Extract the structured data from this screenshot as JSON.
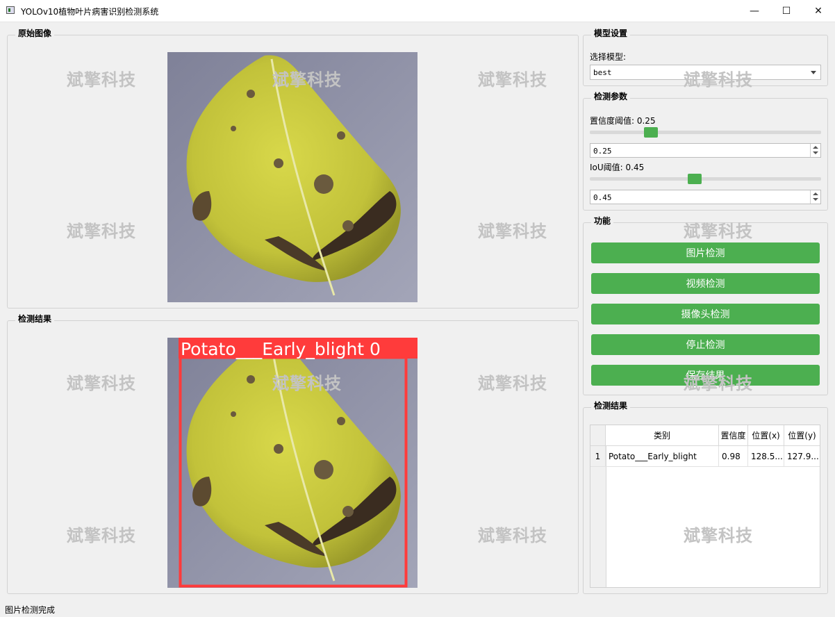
{
  "window": {
    "title": "YOLOv10植物叶片病害识别检测系统",
    "controls": {
      "minimize": "—",
      "maximize": "☐",
      "close": "✕"
    }
  },
  "watermark": "斌擎科技",
  "original_panel": {
    "title": "原始图像"
  },
  "result_panel": {
    "title": "检测结果",
    "detection_label": "Potato___Early_blight 0"
  },
  "model_settings": {
    "title": "模型设置",
    "select_label": "选择模型:",
    "selected_model": "best"
  },
  "params": {
    "title": "检测参数",
    "confidence": {
      "label": "置信度阈值: 0.25",
      "value": "0.25",
      "fraction": 0.25
    },
    "iou": {
      "label": "IoU阈值: 0.45",
      "value": "0.45",
      "fraction": 0.45
    }
  },
  "functions": {
    "title": "功能",
    "buttons": [
      "图片检测",
      "视频检测",
      "摄像头检测",
      "停止检测",
      "保存结果"
    ]
  },
  "results": {
    "title": "检测结果",
    "columns": [
      "类别",
      "置信度",
      "位置(x)",
      "位置(y)"
    ],
    "rows": [
      {
        "index": "1",
        "class": "Potato___Early_blight",
        "confidence": "0.98",
        "x": "128.5...",
        "y": "127.9..."
      }
    ]
  },
  "status_bar": {
    "text": "图片检测完成"
  },
  "colors": {
    "accent": "#4caf50",
    "bbox": "#ff3b3b",
    "leaf": "#c9c93a"
  }
}
